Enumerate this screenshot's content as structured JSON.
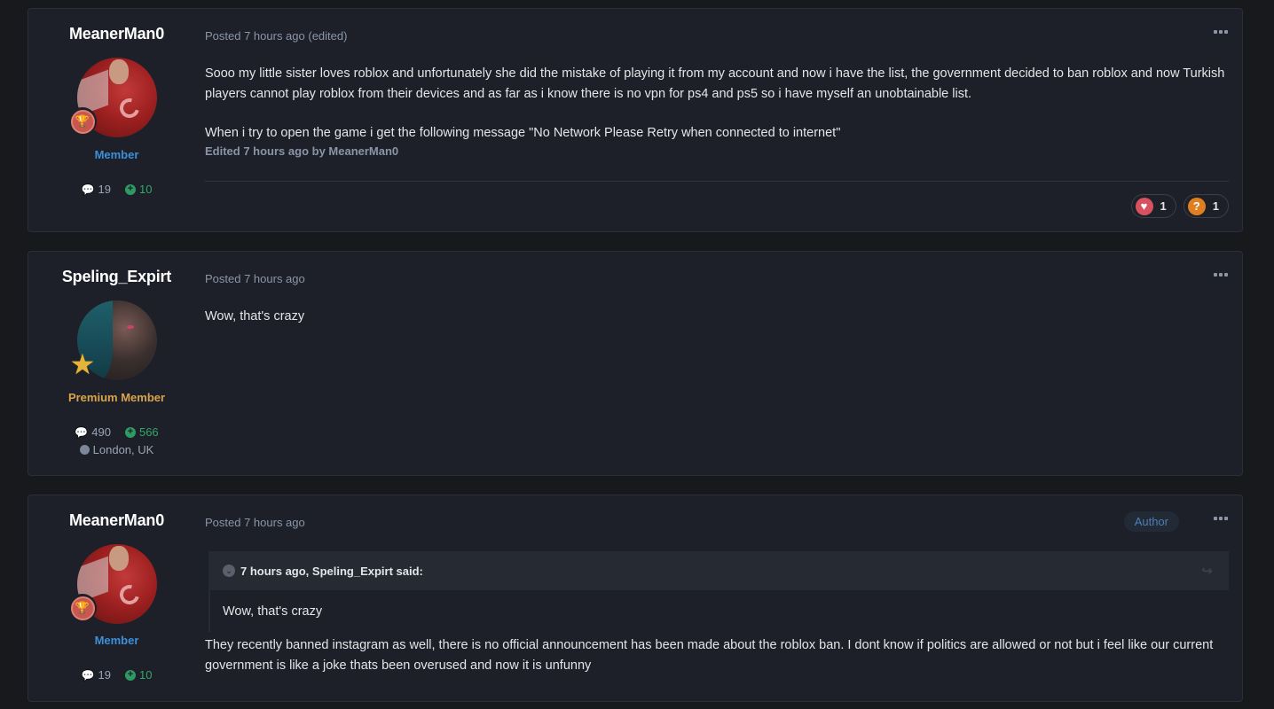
{
  "posts": [
    {
      "author": "MeanerMan0",
      "rank": "Member",
      "rank_type": "member",
      "content_count": "19",
      "reputation": "10",
      "meta": "Posted 7 hours ago (edited)",
      "body_paragraphs": [
        "Sooo my little sister loves roblox and unfortunately she did the mistake of playing it from my account and now i have the list, the government decided to ban roblox and now Turkish players cannot play roblox from their devices and as far as i know there is no vpn for ps4 and ps5 so i have myself an unobtainable list.",
        "When i try to open the game i get the following message \"No Network Please Retry when connected to internet\""
      ],
      "edited_note": "Edited 7 hours ago by MeanerMan0",
      "reactions": [
        {
          "icon": "heart-icon",
          "count": "1",
          "color": "#d7525e"
        },
        {
          "icon": "question-icon",
          "count": "1",
          "color": "#e07f22"
        }
      ]
    },
    {
      "author": "Speling_Expirt",
      "rank": "Premium Member",
      "rank_type": "premium",
      "content_count": "490",
      "reputation": "566",
      "location": "London, UK",
      "meta": "Posted 7 hours ago",
      "body": "Wow, that's crazy"
    },
    {
      "author": "MeanerMan0",
      "rank": "Member",
      "rank_type": "member",
      "content_count": "19",
      "reputation": "10",
      "meta": "Posted 7 hours ago",
      "author_badge": "Author",
      "quote": {
        "header": "7 hours ago, Speling_Expirt said:",
        "body": "Wow, that's crazy"
      },
      "body": "They recently banned instagram as well, there is no official announcement has been made about the roblox ban. I dont know if politics are allowed or not but i feel like our current government is like a joke thats been overused and now it is unfunny"
    }
  ],
  "icons": {
    "more": "•••",
    "comment": "💬",
    "plus": "+",
    "trophy": "🏆",
    "star": "★",
    "heart": "♥",
    "question": "?",
    "chevron_down": "⌄",
    "share": "↪"
  },
  "colors": {
    "page_bg": "#17191d",
    "card_bg": "#1d2028",
    "member": "#3c8fd8",
    "premium": "#d9a34c",
    "reputation": "#35a46d",
    "meta": "#8a95a8"
  }
}
